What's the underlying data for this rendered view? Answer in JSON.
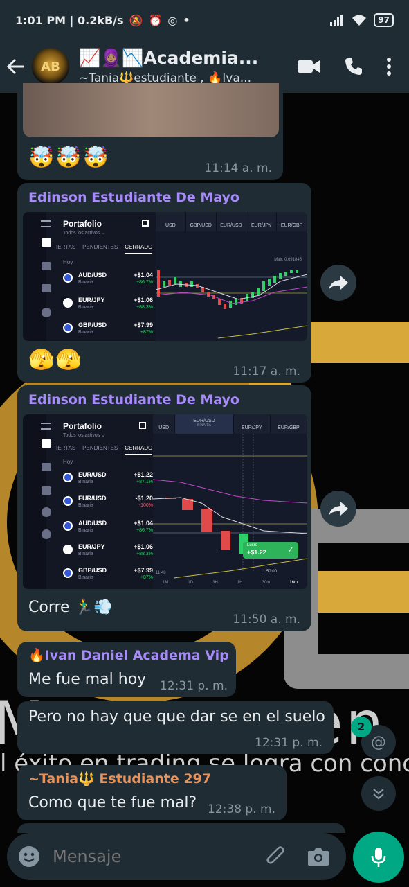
{
  "status_bar": {
    "time_speed": "1:01 PM | 0.2kB/s",
    "dot": "•",
    "battery": "97"
  },
  "header": {
    "avatar_text": "AB",
    "title": "📈🧕🏽📉Academia...",
    "subtitle": "~Tania🔱estudiante , 🔥Iva..."
  },
  "wallpaper": {
    "big_text": "Maestros en Binar",
    "small_text": "l éxito en trading se logra con conocimie"
  },
  "messages": [
    {
      "emoji": "🤯🤯🤯",
      "time": "11:14 a. m."
    },
    {
      "sender": "Edinson Estudiante De Mayo",
      "emoji": "🫣🫣",
      "time": "11:17 a. m.",
      "screenshot": {
        "title": "Portafolio",
        "subtitle": "Todos los activos ⌄",
        "tabs": [
          "IERTAS",
          "PENDIENTES",
          "CERRADO"
        ],
        "hoy": "Hoy",
        "chart_tabs": [
          "USD",
          "GBP/USD",
          "EUR/USD",
          "EUR/JPY",
          "EUR/GBP"
        ],
        "max_label": "Max. 0.691845",
        "rows": [
          {
            "pair": "AUD/USD",
            "kind": "Binaria",
            "amount": "+$1.04",
            "pct": "+86.7%"
          },
          {
            "pair": "EUR/JPY",
            "kind": "Binaria",
            "amount": "+$1.06",
            "pct": "+88.3%"
          },
          {
            "pair": "GBP/USD",
            "kind": "Binaria",
            "amount": "+$7.99",
            "pct": "+87%"
          }
        ]
      }
    },
    {
      "sender": "Edinson Estudiante De Mayo",
      "text": "Corre 🏃‍♂️💨",
      "time": "11:50 a. m.",
      "screenshot": {
        "title": "Portafolio",
        "subtitle": "Todos los activos ⌄",
        "tabs": [
          "IERTAS",
          "PENDIENTES",
          "CERRADO"
        ],
        "hoy": "Hoy",
        "chart_tabs": [
          "USD",
          "EUR/USD",
          "EUR/JPY",
          "EUR/GBP"
        ],
        "chart_tab_sub": "BINARIA",
        "lucro_label": "Lucro",
        "lucro_value": "+$1.22",
        "time_marks": [
          "11:48",
          "11:50:00"
        ],
        "bottom_ticks": [
          "1M",
          "1D",
          "3H",
          "1H",
          "30m",
          "16m"
        ],
        "rows": [
          {
            "pair": "EUR/USD",
            "kind": "Binaria",
            "amount": "+$1.22",
            "pct": "+87.1%"
          },
          {
            "pair": "EUR/USD",
            "kind": "Binaria",
            "amount": "-$1.20",
            "pct": "-100%"
          },
          {
            "pair": "AUD/USD",
            "kind": "Binaria",
            "amount": "+$1.04",
            "pct": "+86.7%"
          },
          {
            "pair": "EUR/JPY",
            "kind": "Binaria",
            "amount": "+$1.06",
            "pct": "+88.3%"
          },
          {
            "pair": "GBP/USD",
            "kind": "Binaria",
            "amount": "+$7.99",
            "pct": "+87%"
          }
        ]
      }
    },
    {
      "sender": "🔥Ivan Daniel Academa Vip",
      "text": "Me fue mal hoy",
      "time": "12:31 p. m."
    },
    {
      "text": "Pero no hay que que dar se en el suelo",
      "time": "12:31 p. m."
    },
    {
      "sender": "~Tania🔱 Estudiante 297",
      "text": "Como que te fue mal?",
      "time": "12:38 p. m."
    }
  ],
  "unread_badge": "2",
  "mention_symbol": "@",
  "composer": {
    "placeholder": "Mensaje"
  },
  "colors": {
    "accent": "#00a884",
    "bubble": "#1f2c34",
    "sender_purple": "#a88bfa",
    "sender_orange": "#e8935b",
    "profit_green": "#2fd06a",
    "loss_red": "#f0556a"
  }
}
